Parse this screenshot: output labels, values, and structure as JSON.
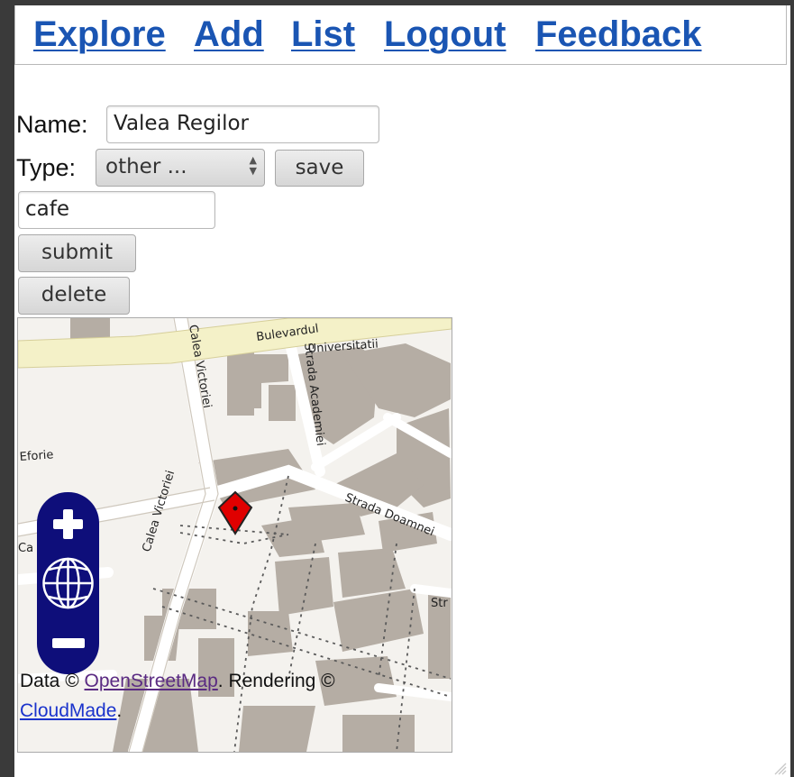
{
  "nav": {
    "explore": "Explore",
    "add": "Add",
    "list": "List",
    "logout": "Logout",
    "feedback": "Feedback",
    "link_color": "#1a55b3"
  },
  "form": {
    "name_label": "Name:",
    "name_value": "Valea Regilor",
    "type_label": "Type:",
    "type_selected": "other ...",
    "save_label": "save",
    "custom_type_value": "cafe",
    "submit_label": "submit",
    "delete_label": "delete"
  },
  "map": {
    "streets": {
      "bulevardul": "Bulevardul",
      "universitatii": "Universitatii",
      "calea_victoriei_top": "Calea Victoriei",
      "strada_academiei": "Strada Academiei",
      "eforie": "Eforie",
      "calea_victoriei_bottom": "Calea Victoriei",
      "strada_doamnei": "Strada Doamnei",
      "ca_partial": "Ca",
      "str_partial": "Str"
    },
    "attribution": {
      "data_prefix": "Data © ",
      "osm": "OpenStreetMap",
      "rendering": ". Rendering © ",
      "cloudmade": "CloudMade",
      "end": ".",
      "visited_link_color": "#5a2a82",
      "link_color": "#1a33cc"
    },
    "zoom_plus_icon": "plus-icon",
    "zoom_world_icon": "globe-icon",
    "zoom_minus_icon": "minus-icon",
    "marker_icon": "map-marker-icon",
    "marker_color": "#e00000",
    "zoom_color": "#0e0e7a"
  }
}
